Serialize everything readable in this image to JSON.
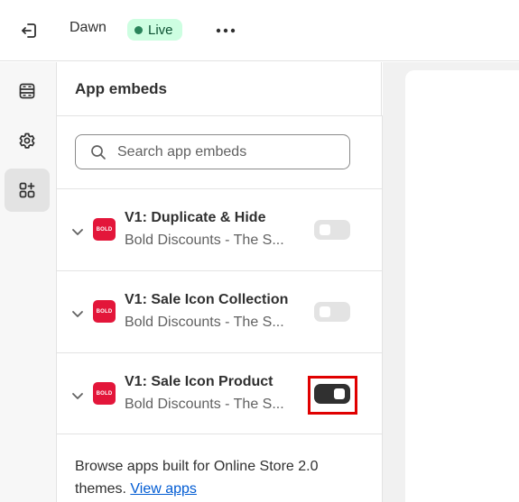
{
  "topbar": {
    "theme_name": "Dawn",
    "status_badge": "Live",
    "exit_icon": "exit-icon",
    "more_icon": "more-horizontal-icon"
  },
  "siderail": {
    "items": [
      {
        "icon": "sections-icon",
        "active": false
      },
      {
        "icon": "settings-icon",
        "active": false
      },
      {
        "icon": "app-embeds-icon",
        "active": true
      }
    ]
  },
  "panel": {
    "title": "App embeds",
    "search": {
      "placeholder": "Search app embeds",
      "value": ""
    },
    "embeds": [
      {
        "name": "V1: Duplicate & Hide",
        "app": "Bold Discounts - The S...",
        "logo_text": "BOLD",
        "enabled": false
      },
      {
        "name": "V1: Sale Icon Collection",
        "app": "Bold Discounts - The S...",
        "logo_text": "BOLD",
        "enabled": false
      },
      {
        "name": "V1: Sale Icon Product",
        "app": "Bold Discounts - The S...",
        "logo_text": "BOLD",
        "enabled": true,
        "highlighted": true
      }
    ],
    "browse_text": "Browse apps built for Online Store 2.0 themes.",
    "browse_link": "View apps"
  },
  "colors": {
    "live_badge_bg": "#cdfee1",
    "live_dot": "#29845a",
    "bold_logo": "#e3163a",
    "toggle_on": "#303030",
    "highlight_box": "#e00000",
    "link": "#005bd3"
  }
}
